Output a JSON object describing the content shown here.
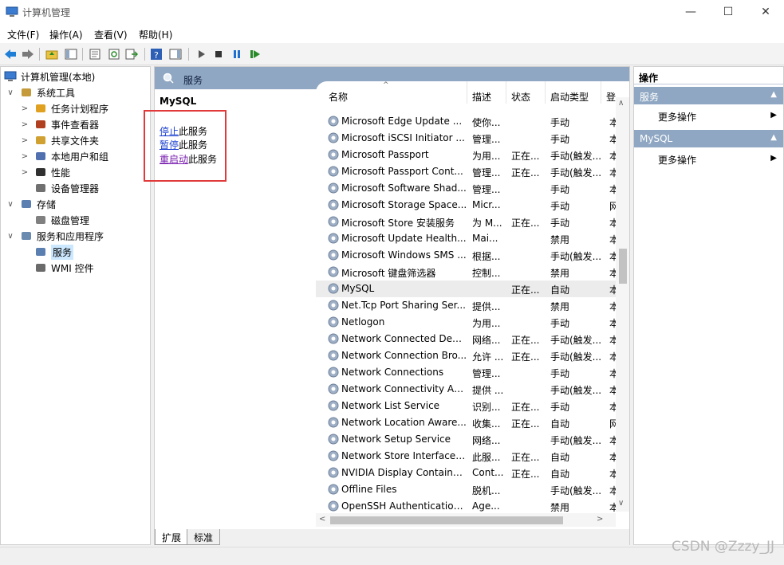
{
  "window": {
    "title": "计算机管理"
  },
  "menu": [
    "文件(F)",
    "操作(A)",
    "查看(V)",
    "帮助(H)"
  ],
  "tree": {
    "root": "计算机管理(本地)",
    "items": [
      {
        "label": "系统工具",
        "level": 1,
        "chevron": "down"
      },
      {
        "label": "任务计划程序",
        "level": 2,
        "chevron": "right"
      },
      {
        "label": "事件查看器",
        "level": 2,
        "chevron": "right"
      },
      {
        "label": "共享文件夹",
        "level": 2,
        "chevron": "right"
      },
      {
        "label": "本地用户和组",
        "level": 2,
        "chevron": "right"
      },
      {
        "label": "性能",
        "level": 2,
        "chevron": "right"
      },
      {
        "label": "设备管理器",
        "level": 2,
        "chevron": ""
      },
      {
        "label": "存储",
        "level": 1,
        "chevron": "down"
      },
      {
        "label": "磁盘管理",
        "level": 2,
        "chevron": ""
      },
      {
        "label": "服务和应用程序",
        "level": 1,
        "chevron": "down"
      },
      {
        "label": "服务",
        "level": 2,
        "chevron": "",
        "selected": true
      },
      {
        "label": "WMI 控件",
        "level": 2,
        "chevron": ""
      }
    ]
  },
  "center": {
    "header": "服务",
    "ext": {
      "service_name": "MySQL",
      "stop_link": "停止",
      "stop_rest": "此服务",
      "pause_link": "暂停",
      "pause_rest": "此服务",
      "restart_link": "重启动",
      "restart_rest": "此服务"
    },
    "columns": {
      "name": "名称",
      "desc": "描述",
      "state": "状态",
      "start": "启动类型",
      "log": "登"
    },
    "rows": [
      {
        "name": "Microsoft Edge Update ...",
        "desc": "使你...",
        "state": "",
        "start": "手动",
        "log": "本"
      },
      {
        "name": "Microsoft iSCSI Initiator ...",
        "desc": "管理...",
        "state": "",
        "start": "手动",
        "log": "本"
      },
      {
        "name": "Microsoft Passport",
        "desc": "为用...",
        "state": "正在...",
        "start": "手动(触发...",
        "log": "本"
      },
      {
        "name": "Microsoft Passport Cont...",
        "desc": "管理...",
        "state": "正在...",
        "start": "手动(触发...",
        "log": "本"
      },
      {
        "name": "Microsoft Software Shad...",
        "desc": "管理...",
        "state": "",
        "start": "手动",
        "log": "本"
      },
      {
        "name": "Microsoft Storage Space...",
        "desc": "Micr...",
        "state": "",
        "start": "手动",
        "log": "网"
      },
      {
        "name": "Microsoft Store 安装服务",
        "desc": "为 M...",
        "state": "正在...",
        "start": "手动",
        "log": "本"
      },
      {
        "name": "Microsoft Update Health...",
        "desc": "Mai...",
        "state": "",
        "start": "禁用",
        "log": "本"
      },
      {
        "name": "Microsoft Windows SMS ...",
        "desc": "根据...",
        "state": "",
        "start": "手动(触发...",
        "log": "本"
      },
      {
        "name": "Microsoft 键盘筛选器",
        "desc": "控制...",
        "state": "",
        "start": "禁用",
        "log": "本"
      },
      {
        "name": "MySQL",
        "desc": "",
        "state": "正在...",
        "start": "自动",
        "log": "本",
        "selected": true
      },
      {
        "name": "Net.Tcp Port Sharing Ser...",
        "desc": "提供...",
        "state": "",
        "start": "禁用",
        "log": "本"
      },
      {
        "name": "Netlogon",
        "desc": "为用...",
        "state": "",
        "start": "手动",
        "log": "本"
      },
      {
        "name": "Network Connected Devi...",
        "desc": "网络...",
        "state": "正在...",
        "start": "手动(触发...",
        "log": "本"
      },
      {
        "name": "Network Connection Bro...",
        "desc": "允许 ...",
        "state": "正在...",
        "start": "手动(触发...",
        "log": "本"
      },
      {
        "name": "Network Connections",
        "desc": "管理...",
        "state": "",
        "start": "手动",
        "log": "本"
      },
      {
        "name": "Network Connectivity Ass...",
        "desc": "提供 ...",
        "state": "",
        "start": "手动(触发...",
        "log": "本"
      },
      {
        "name": "Network List Service",
        "desc": "识别...",
        "state": "正在...",
        "start": "手动",
        "log": "本"
      },
      {
        "name": "Network Location Aware...",
        "desc": "收集...",
        "state": "正在...",
        "start": "自动",
        "log": "网"
      },
      {
        "name": "Network Setup Service",
        "desc": "网络...",
        "state": "",
        "start": "手动(触发...",
        "log": "本"
      },
      {
        "name": "Network Store Interface ...",
        "desc": "此服...",
        "state": "正在...",
        "start": "自动",
        "log": "本"
      },
      {
        "name": "NVIDIA Display Containe...",
        "desc": "Cont...",
        "state": "正在...",
        "start": "自动",
        "log": "本"
      },
      {
        "name": "Offline Files",
        "desc": "脱机...",
        "state": "",
        "start": "手动(触发...",
        "log": "本"
      },
      {
        "name": "OpenSSH Authentication ...",
        "desc": "Age...",
        "state": "",
        "start": "禁用",
        "log": "本"
      }
    ],
    "tabs": [
      "扩展",
      "标准"
    ]
  },
  "actions": {
    "header": "操作",
    "sections": [
      {
        "title": "服务",
        "item": "更多操作"
      },
      {
        "title": "MySQL",
        "item": "更多操作"
      }
    ]
  },
  "watermark": "CSDN @Zzzy_JJ"
}
